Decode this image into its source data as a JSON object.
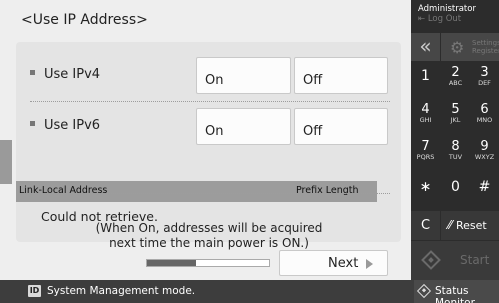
{
  "page": {
    "title": "<Use IP Address>"
  },
  "rows": {
    "ipv4": {
      "label": "Use IPv4",
      "on": "On",
      "off": "Off"
    },
    "ipv6": {
      "label": "Use IPv6",
      "on": "On",
      "off": "Off"
    }
  },
  "link_local": {
    "col_address": "Link-Local Address",
    "col_prefix": "Prefix Length",
    "value": "Could not retrieve."
  },
  "note": {
    "line1": "(When On, addresses will be acquired",
    "line2": "next time the main power is ON.)"
  },
  "navigation": {
    "next_label": "Next",
    "progress_fraction": 0.4
  },
  "sidebar": {
    "user": "Administrator",
    "logout": "Log Out",
    "back_glyph": "«",
    "settings_line1": "Settings/",
    "settings_line2": "Register",
    "keys": [
      {
        "digit": "1",
        "sub": ""
      },
      {
        "digit": "2",
        "sub": "ABC"
      },
      {
        "digit": "3",
        "sub": "DEF"
      },
      {
        "digit": "4",
        "sub": "GHI"
      },
      {
        "digit": "5",
        "sub": "JKL"
      },
      {
        "digit": "6",
        "sub": "MNO"
      },
      {
        "digit": "7",
        "sub": "PQRS"
      },
      {
        "digit": "8",
        "sub": "TUV"
      },
      {
        "digit": "9",
        "sub": "WXYZ"
      },
      {
        "digit": "∗",
        "sub": ""
      },
      {
        "digit": "0",
        "sub": ""
      },
      {
        "digit": "#",
        "sub": ""
      }
    ],
    "clear_label": "C",
    "reset_label": "Reset",
    "start_label": "Start"
  },
  "status": {
    "id_badge": "ID",
    "message": "System Management mode.",
    "monitor_label": "Status Monitor"
  },
  "icons": {
    "back": "chevron-double-left-icon",
    "settings": "gear-icon",
    "reset": "reset-icon",
    "start": "start-diamond-icon",
    "status_monitor": "status-monitor-icon",
    "id": "id-badge-icon",
    "next": "arrow-right-icon"
  },
  "colors": {
    "keypad_bg": "#2c2c2c",
    "statusbar_bg": "#3d3d3d",
    "panel_bg": "#eeeeee",
    "card_bg": "#e4e4e4",
    "header_bg": "#9c9c9c"
  }
}
